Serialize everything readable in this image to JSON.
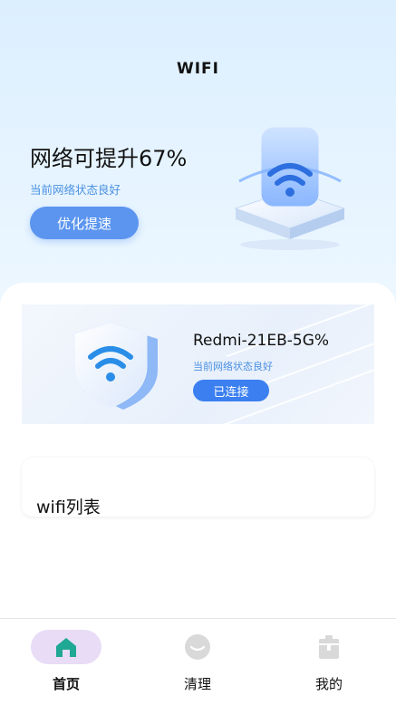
{
  "header": {
    "title": "WIFI"
  },
  "hero": {
    "headline": "网络可提升67%",
    "subline": "当前网络状态良好",
    "optimize_label": "优化提速"
  },
  "current_network": {
    "name": "Redmi-21EB-5G%",
    "status": "当前网络状态良好",
    "connected_label": "已连接"
  },
  "wifi_list": {
    "title": "wifi列表"
  },
  "tabbar": {
    "tabs": [
      {
        "label": "首页",
        "icon": "home-icon",
        "active": true
      },
      {
        "label": "清理",
        "icon": "clean-icon",
        "active": false
      },
      {
        "label": "我的",
        "icon": "profile-icon",
        "active": false
      }
    ]
  },
  "colors": {
    "accent": "#5b95f0",
    "connected": "#3b7ff0",
    "status_text": "#4a90e2",
    "active_tab_bg": "#e8dcf7",
    "home_icon": "#1fa894",
    "inactive_icon": "#d9d9d9"
  }
}
